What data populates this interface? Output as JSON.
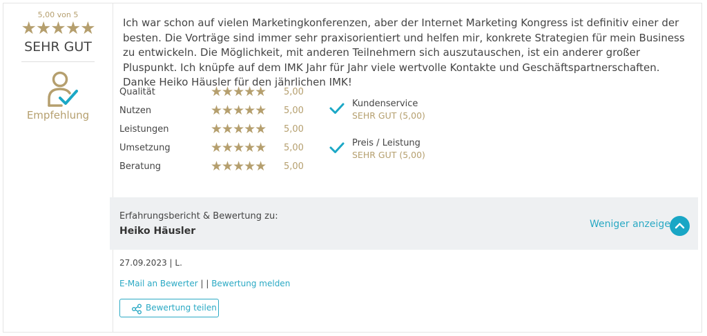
{
  "summary": {
    "score_label": "5,00 von 5",
    "stars": "★★★★★",
    "rating_word": "SEHR GUT",
    "recommendation": "Empfehlung"
  },
  "review": {
    "text": "Ich war schon auf vielen Marketingkonferenzen, aber der Internet Marketing Kongress ist definitiv einer der besten. Die Vorträge sind immer sehr praxisorientiert und helfen mir, konkrete Strategien für mein Business zu entwickeln. Die Möglichkeit, mit anderen Teilnehmern sich auszutauschen, ist ein anderer großer Pluspunkt. Ich knüpfe auf dem IMK Jahr für Jahr viele wertvolle Kontakte und Geschäftspartnerschaften. Danke Heiko Häusler für den jährlichen IMK!"
  },
  "criteria": [
    {
      "name": "Qualität",
      "stars": "★★★★★",
      "value": "5,00"
    },
    {
      "name": "Nutzen",
      "stars": "★★★★★",
      "value": "5,00"
    },
    {
      "name": "Leistungen",
      "stars": "★★★★★",
      "value": "5,00"
    },
    {
      "name": "Umsetzung",
      "stars": "★★★★★",
      "value": "5,00"
    },
    {
      "name": "Beratung",
      "stars": "★★★★★",
      "value": "5,00"
    }
  ],
  "services": [
    {
      "name": "Kundenservice",
      "value": "SEHR GUT (5,00)"
    },
    {
      "name": "Preis / Leistung",
      "value": "SEHR GUT (5,00)"
    }
  ],
  "footer": {
    "label": "Erfahrungsbericht & Bewertung zu:",
    "name": "Heiko Häusler",
    "less_link": "Weniger anzeigen"
  },
  "meta": {
    "date_author": "27.09.2023 | L.",
    "email_link": "E-Mail an Bewerter",
    "separator": " | | ",
    "report_link": "Bewertung melden",
    "share_label": "Bewertung teilen"
  },
  "colors": {
    "gold": "#b59f6e",
    "accent": "#2aa9c4",
    "button": "#19a6c5"
  },
  "icons": {
    "recommendation": "user-check-icon",
    "service_check": "checkmark-icon",
    "collapse": "chevron-up-icon",
    "share": "share-icon"
  }
}
